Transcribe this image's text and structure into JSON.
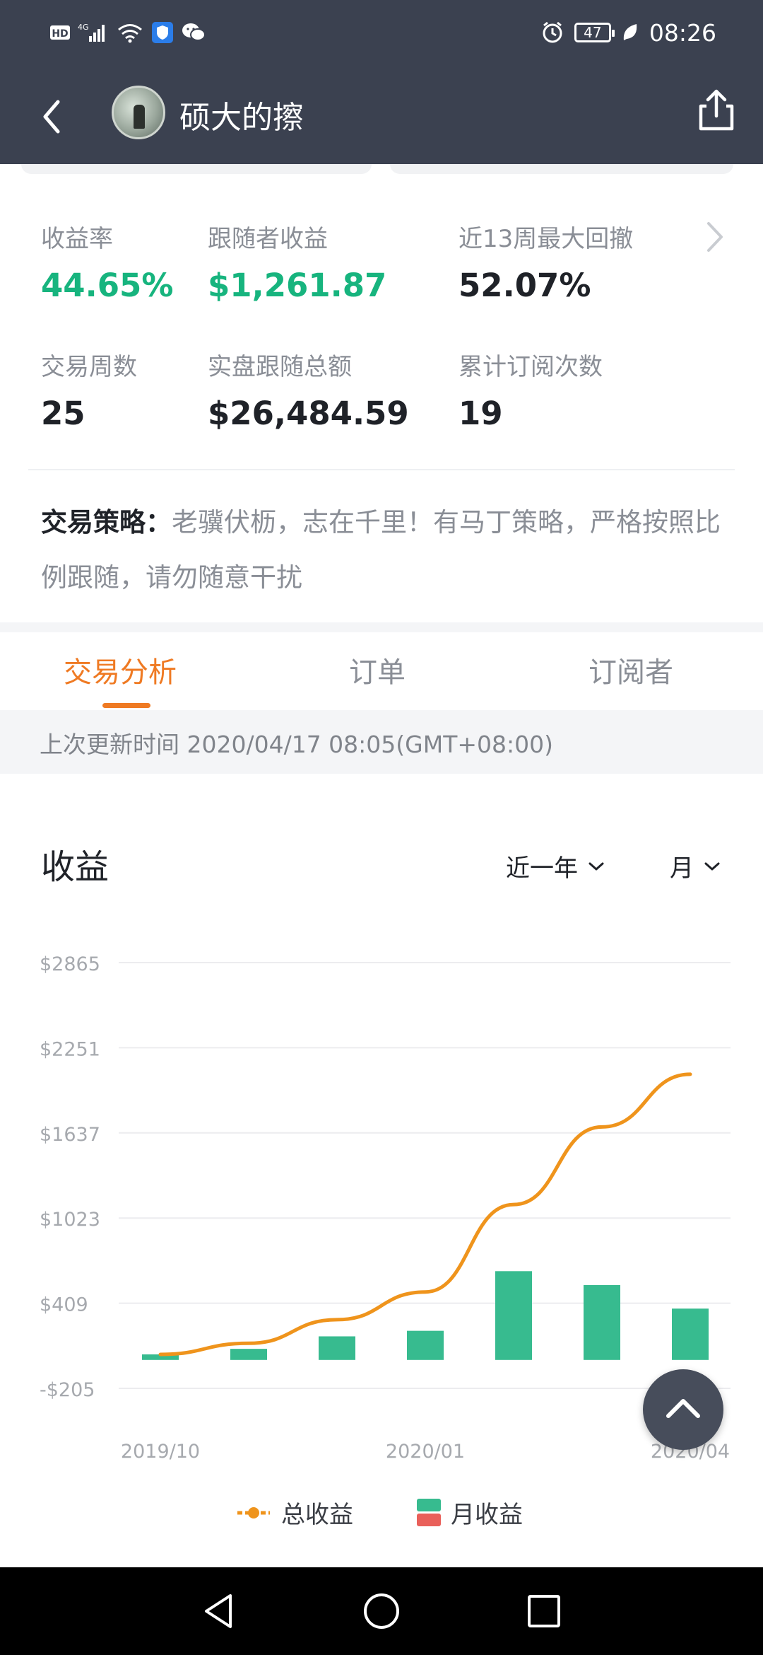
{
  "statusbar": {
    "time": "08:26",
    "battery": "47",
    "left_icons": [
      "hd-icon",
      "signal-4g-icon",
      "wifi-icon",
      "vpn-shield-icon",
      "wechat-icon"
    ]
  },
  "header": {
    "title": "硕大的擦"
  },
  "stats": [
    {
      "label": "收益率",
      "value": "44.65%",
      "color": "#17b47e"
    },
    {
      "label": "跟随者收益",
      "value": "$1,261.87",
      "color": "#17b47e"
    },
    {
      "label": "近13周最大回撤",
      "value": "52.07%",
      "color": "#1f2228"
    },
    {
      "label": "交易周数",
      "value": "25",
      "color": "#1f2228"
    },
    {
      "label": "实盘跟随总额",
      "value": "$26,484.59",
      "color": "#1f2228"
    },
    {
      "label": "累计订阅次数",
      "value": "19",
      "color": "#1f2228"
    }
  ],
  "strategy": {
    "label": "交易策略：",
    "text": "老骥伏枥，志在千里！有马丁策略，严格按照比例跟随，请勿随意干扰"
  },
  "tabs": [
    "交易分析",
    "订单",
    "订阅者"
  ],
  "update": "上次更新时间 2020/04/17 08:05(GMT+08:00)",
  "chart_section": {
    "title": "收益",
    "period": "近一年",
    "interval": "月"
  },
  "chart_data": {
    "type": "bar",
    "title": "收益",
    "y_ticks": [
      "$2865",
      "$2251",
      "$1637",
      "$1023",
      "$409",
      "-$205"
    ],
    "y_tick_values": [
      2865,
      2251,
      1637,
      1023,
      409,
      -205
    ],
    "ylim": [
      -205,
      2865
    ],
    "x_tick_labels": [
      "2019/10",
      "2020/01",
      "2020/04"
    ],
    "categories": [
      "2019/10",
      "2019/11",
      "2019/12",
      "2020/01",
      "2020/02",
      "2020/03",
      "2020/04"
    ],
    "series": [
      {
        "name": "总收益",
        "type": "line",
        "color": "#ef941c",
        "values": [
          40,
          120,
          290,
          490,
          1120,
          1680,
          2060
        ]
      },
      {
        "name": "月收益",
        "type": "bar",
        "color": "#37bb8f",
        "negative_color": "#e9605a",
        "values": [
          40,
          80,
          170,
          210,
          640,
          540,
          370
        ]
      }
    ],
    "grid": true,
    "legend": "bottom"
  },
  "colors": {
    "header_bg": "#3b4150",
    "accent": "#ef7a23",
    "positive": "#17b47e"
  }
}
